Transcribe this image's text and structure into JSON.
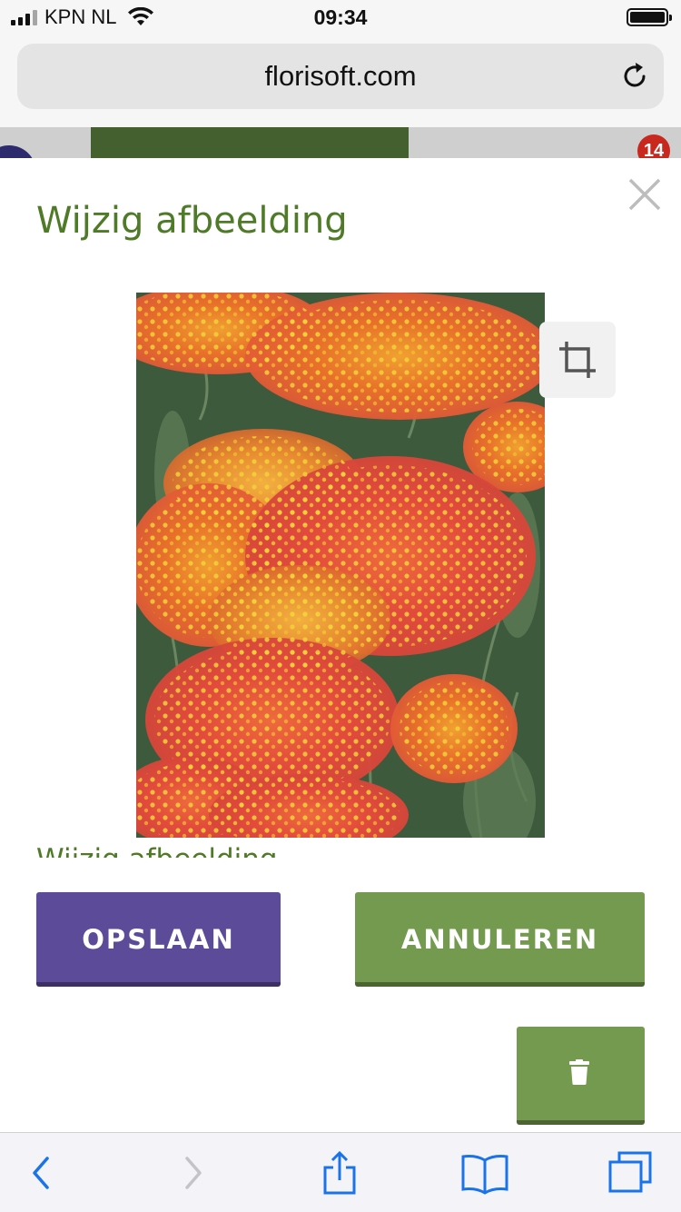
{
  "status_bar": {
    "carrier": "KPN NL",
    "time": "09:34"
  },
  "browser": {
    "url": "florisoft.com"
  },
  "background_page": {
    "notification_count": "14"
  },
  "modal": {
    "title": "Wijzig afbeelding",
    "clipped_heading": "Wijzig afbeelding",
    "image_subject": "orange-red yarrow flowers",
    "buttons": {
      "save": "OPSLAAN",
      "cancel": "ANNULEREN"
    }
  },
  "colors": {
    "title_green": "#4f7a28",
    "save_purple": "#5c4b99",
    "cancel_green": "#739a4e",
    "badge_red": "#c8281e",
    "ios_blue": "#1a73e8"
  },
  "icons": {
    "close": "close-icon",
    "crop": "crop-icon",
    "delete": "trash-icon",
    "reload": "reload-icon",
    "back": "chevron-left-icon",
    "forward": "chevron-right-icon",
    "share": "share-icon",
    "bookmarks": "book-icon",
    "tabs": "tabs-icon"
  }
}
